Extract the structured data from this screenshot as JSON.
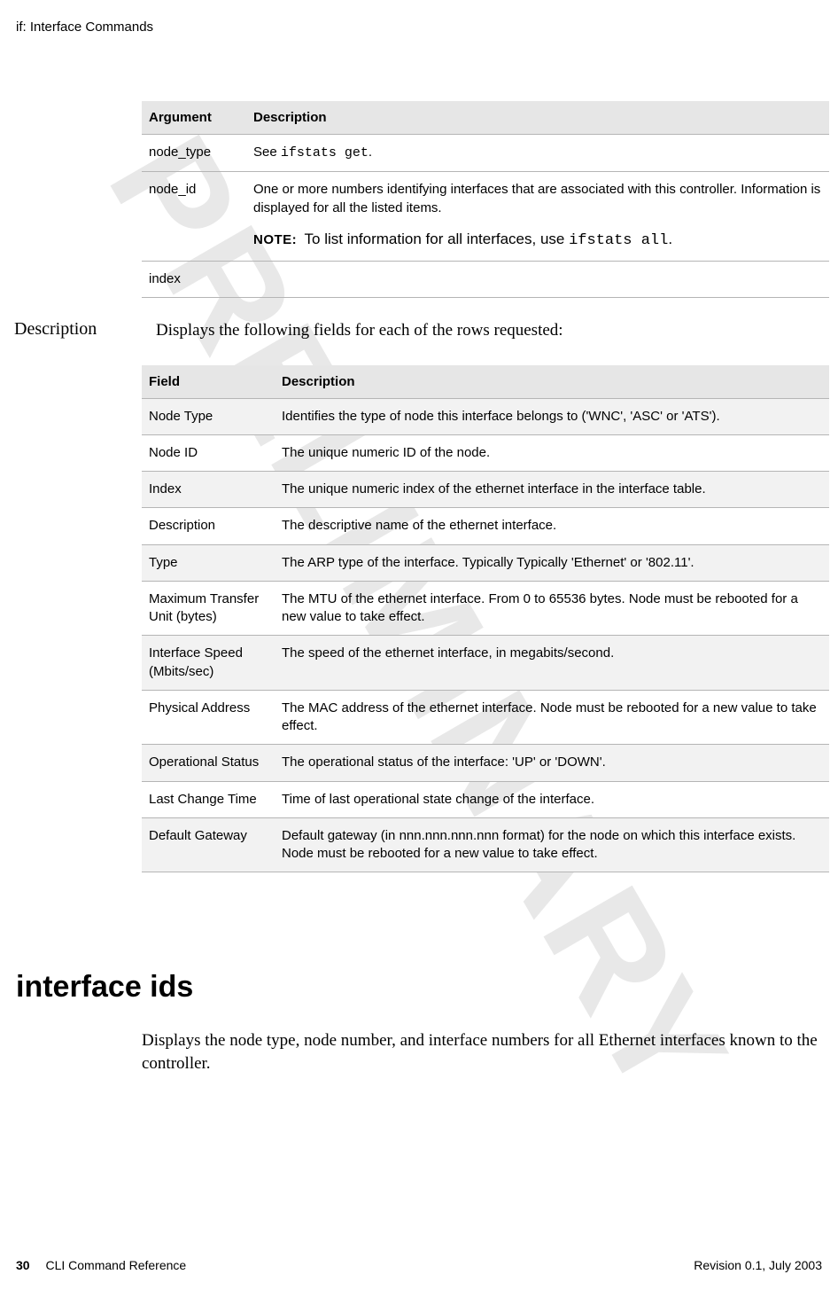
{
  "running_header": "if: Interface Commands",
  "watermark": "PRELIMINARY",
  "arg_table": {
    "headers": {
      "col1": "Argument",
      "col2": "Description"
    },
    "rows": [
      {
        "arg": "node_type",
        "desc_pre": "See ",
        "desc_code": "ifstats get",
        "desc_post": "."
      },
      {
        "arg": "node_id",
        "desc_line1": "One or more numbers identifying interfaces that are associated with this controller. Information is displayed for all the listed items.",
        "note_label": "NOTE:",
        "note_pre": "To list information for all interfaces, use ",
        "note_code": "ifstats all",
        "note_post": "."
      },
      {
        "arg": "index",
        "desc": ""
      }
    ]
  },
  "description_label": "Description",
  "description_text": "Displays the following fields for each of the rows requested:",
  "field_table": {
    "headers": {
      "col1": "Field",
      "col2": "Description"
    },
    "rows": [
      {
        "field": "Node Type",
        "desc": "Identifies the type of node this interface belongs to ('WNC', 'ASC' or 'ATS')."
      },
      {
        "field": "Node ID",
        "desc": "The unique numeric ID of the node."
      },
      {
        "field": "Index",
        "desc": "The unique numeric index of the ethernet interface in the interface table."
      },
      {
        "field": "Description",
        "desc": "The descriptive name of the ethernet interface."
      },
      {
        "field": "Type",
        "desc": "The ARP type of the interface. Typically Typically 'Ethernet' or '802.11'."
      },
      {
        "field": "Maximum Transfer Unit (bytes)",
        "desc": "The MTU of the ethernet interface. From 0 to 65536 bytes. Node must be rebooted for a new value to take effect."
      },
      {
        "field": "Interface Speed (Mbits/sec)",
        "desc": "The speed of the ethernet interface, in megabits/second."
      },
      {
        "field": "Physical Address",
        "desc": "The MAC address of the ethernet interface. Node must be rebooted for a new value to take effect."
      },
      {
        "field": "Operational Status",
        "desc": "The operational status of the interface: 'UP' or 'DOWN'."
      },
      {
        "field": "Last Change Time",
        "desc": "Time of last operational state change of the interface."
      },
      {
        "field": "Default Gateway",
        "desc": "Default gateway (in nnn.nnn.nnn.nnn format) for the node on which this interface exists. Node must be rebooted for a new value to take effect."
      }
    ]
  },
  "command_heading": "interface ids",
  "command_intro": "Displays the node type, node number, and interface numbers for all Ethernet interfaces known to the controller.",
  "footer": {
    "page_number": "30",
    "doc_title": "CLI Command Reference",
    "revision": "Revision 0.1, July 2003"
  }
}
